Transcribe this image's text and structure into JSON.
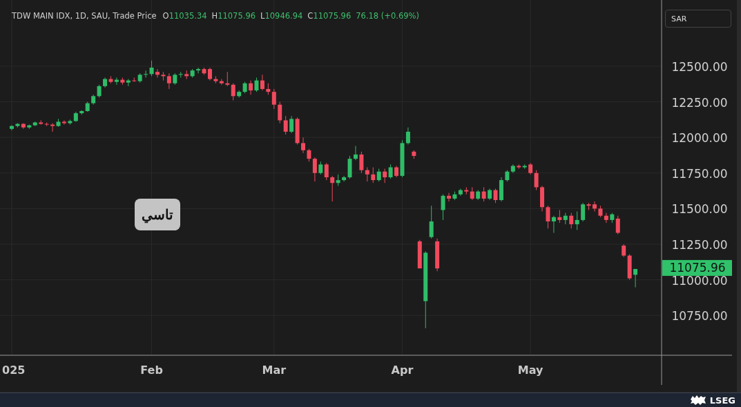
{
  "legend": {
    "symbol": "TDW MAIN IDX, 1D, SAU, Trade Price",
    "open_label": "O",
    "open": "11035.34",
    "high_label": "H",
    "high": "11075.96",
    "low_label": "L",
    "low": "10946.94",
    "close_label": "C",
    "close": "11075.96",
    "change": "76.18 (+0.69%)"
  },
  "currency_button": "SAR",
  "chart_label": "تاسي",
  "chart_data": {
    "type": "candlestick",
    "grid": true,
    "ylim": [
      10470,
      12965
    ],
    "yticks": [
      {
        "value": 10750,
        "label": "10750.00"
      },
      {
        "value": 11000,
        "label": "11000.00"
      },
      {
        "value": 11250,
        "label": "11250.00"
      },
      {
        "value": 11500,
        "label": "11500.00"
      },
      {
        "value": 11750,
        "label": "11750.00"
      },
      {
        "value": 12000,
        "label": "12000.00"
      },
      {
        "value": 12250,
        "label": "12250.00"
      },
      {
        "value": 12500,
        "label": "12500.00"
      }
    ],
    "categories": [
      "025",
      null,
      null,
      null,
      null,
      null,
      null,
      null,
      null,
      null,
      null,
      null,
      null,
      null,
      null,
      null,
      null,
      null,
      null,
      null,
      null,
      null,
      null,
      null,
      "Feb",
      null,
      null,
      null,
      null,
      null,
      null,
      null,
      null,
      null,
      null,
      null,
      null,
      null,
      null,
      null,
      null,
      null,
      null,
      null,
      null,
      "Mar",
      null,
      null,
      null,
      null,
      null,
      null,
      null,
      null,
      null,
      null,
      null,
      null,
      null,
      null,
      null,
      null,
      null,
      null,
      null,
      null,
      null,
      "Apr",
      null,
      null,
      null,
      null,
      null,
      null,
      null,
      null,
      null,
      null,
      null,
      null,
      null,
      null,
      null,
      null,
      null,
      null,
      null,
      null,
      null,
      "May",
      null,
      null,
      null,
      null,
      null,
      null,
      null,
      null,
      null,
      null,
      null,
      null,
      null,
      null,
      null,
      null,
      null,
      null
    ],
    "ohlc": [
      [
        12060,
        12085,
        12050,
        12080
      ],
      [
        12080,
        12100,
        12070,
        12095
      ],
      [
        12095,
        12100,
        12060,
        12070
      ],
      [
        12070,
        12090,
        12060,
        12085
      ],
      [
        12085,
        12110,
        12080,
        12105
      ],
      [
        12105,
        12120,
        12090,
        12095
      ],
      [
        12095,
        12105,
        12080,
        12090
      ],
      [
        12090,
        12100,
        12040,
        12080
      ],
      [
        12080,
        12130,
        12075,
        12110
      ],
      [
        12110,
        12120,
        12090,
        12100
      ],
      [
        12100,
        12125,
        12090,
        12115
      ],
      [
        12115,
        12180,
        12110,
        12170
      ],
      [
        12170,
        12190,
        12160,
        12185
      ],
      [
        12185,
        12250,
        12180,
        12240
      ],
      [
        12240,
        12300,
        12230,
        12290
      ],
      [
        12290,
        12370,
        12280,
        12360
      ],
      [
        12360,
        12420,
        12350,
        12410
      ],
      [
        12410,
        12430,
        12380,
        12390
      ],
      [
        12390,
        12420,
        12370,
        12405
      ],
      [
        12405,
        12420,
        12370,
        12385
      ],
      [
        12385,
        12410,
        12360,
        12400
      ],
      [
        12400,
        12420,
        12390,
        12395
      ],
      [
        12395,
        12450,
        12385,
        12440
      ],
      [
        12440,
        12470,
        12420,
        12445
      ],
      [
        12445,
        12540,
        12430,
        12490
      ],
      [
        12460,
        12480,
        12420,
        12440
      ],
      [
        12440,
        12460,
        12400,
        12430
      ],
      [
        12430,
        12450,
        12340,
        12380
      ],
      [
        12380,
        12450,
        12370,
        12440
      ],
      [
        12440,
        12460,
        12420,
        12445
      ],
      [
        12445,
        12470,
        12410,
        12430
      ],
      [
        12430,
        12480,
        12420,
        12470
      ],
      [
        12470,
        12490,
        12450,
        12480
      ],
      [
        12480,
        12490,
        12440,
        12450
      ],
      [
        12480,
        12490,
        12400,
        12410
      ],
      [
        12410,
        12430,
        12380,
        12395
      ],
      [
        12395,
        12410,
        12370,
        12380
      ],
      [
        12380,
        12460,
        12360,
        12370
      ],
      [
        12370,
        12380,
        12260,
        12290
      ],
      [
        12290,
        12330,
        12280,
        12320
      ],
      [
        12320,
        12390,
        12310,
        12380
      ],
      [
        12380,
        12400,
        12300,
        12330
      ],
      [
        12330,
        12420,
        12320,
        12400
      ],
      [
        12400,
        12440,
        12330,
        12340
      ],
      [
        12340,
        12380,
        12300,
        12320
      ],
      [
        12320,
        12340,
        12200,
        12230
      ],
      [
        12230,
        12250,
        12100,
        12120
      ],
      [
        12120,
        12150,
        12020,
        12040
      ],
      [
        12040,
        12150,
        12030,
        12130
      ],
      [
        12130,
        12140,
        11950,
        11960
      ],
      [
        11960,
        12000,
        11890,
        11910
      ],
      [
        11910,
        11920,
        11830,
        11850
      ],
      [
        11850,
        11860,
        11690,
        11750
      ],
      [
        11750,
        11830,
        11740,
        11810
      ],
      [
        11810,
        11820,
        11700,
        11720
      ],
      [
        11720,
        11730,
        11550,
        11680
      ],
      [
        11680,
        11740,
        11660,
        11700
      ],
      [
        11700,
        11730,
        11690,
        11720
      ],
      [
        11720,
        11870,
        11710,
        11850
      ],
      [
        11850,
        11940,
        11840,
        11880
      ],
      [
        11880,
        11900,
        11750,
        11770
      ],
      [
        11770,
        11790,
        11690,
        11740
      ],
      [
        11740,
        11790,
        11680,
        11700
      ],
      [
        11700,
        11780,
        11690,
        11760
      ],
      [
        11760,
        11780,
        11680,
        11720
      ],
      [
        11720,
        11810,
        11710,
        11790
      ],
      [
        11790,
        11800,
        11720,
        11730
      ],
      [
        11730,
        11980,
        11720,
        11960
      ],
      [
        11960,
        12070,
        11950,
        12040
      ],
      [
        11900,
        11910,
        11850,
        11870
      ],
      [
        11270,
        11280,
        11080,
        11080
      ],
      [
        10850,
        11200,
        10660,
        11190
      ],
      [
        11300,
        11520,
        11290,
        11410
      ],
      [
        11270,
        11290,
        11060,
        11080
      ],
      [
        11490,
        11600,
        11420,
        11590
      ],
      [
        11590,
        11610,
        11550,
        11570
      ],
      [
        11570,
        11620,
        11560,
        11600
      ],
      [
        11600,
        11640,
        11590,
        11630
      ],
      [
        11630,
        11650,
        11600,
        11620
      ],
      [
        11620,
        11650,
        11560,
        11570
      ],
      [
        11570,
        11630,
        11560,
        11620
      ],
      [
        11620,
        11650,
        11550,
        11570
      ],
      [
        11570,
        11640,
        11560,
        11630
      ],
      [
        11630,
        11640,
        11540,
        11560
      ],
      [
        11560,
        11720,
        11550,
        11700
      ],
      [
        11700,
        11770,
        11690,
        11760
      ],
      [
        11760,
        11810,
        11750,
        11800
      ],
      [
        11800,
        11810,
        11780,
        11790
      ],
      [
        11790,
        11810,
        11780,
        11800
      ],
      [
        11810,
        11820,
        11740,
        11750
      ],
      [
        11750,
        11770,
        11630,
        11650
      ],
      [
        11650,
        11660,
        11480,
        11510
      ],
      [
        11510,
        11520,
        11360,
        11410
      ],
      [
        11410,
        11450,
        11330,
        11440
      ],
      [
        11440,
        11490,
        11400,
        11420
      ],
      [
        11420,
        11470,
        11390,
        11450
      ],
      [
        11450,
        11470,
        11360,
        11390
      ],
      [
        11390,
        11480,
        11350,
        11420
      ],
      [
        11420,
        11540,
        11410,
        11530
      ],
      [
        11530,
        11540,
        11490,
        11520
      ],
      [
        11530,
        11550,
        11480,
        11500
      ],
      [
        11500,
        11520,
        11440,
        11450
      ],
      [
        11450,
        11470,
        11400,
        11420
      ],
      [
        11420,
        11470,
        11400,
        11460
      ],
      [
        11430,
        11450,
        11320,
        11330
      ],
      [
        11240,
        11250,
        11160,
        11170
      ],
      [
        11170,
        11180,
        11000,
        11010
      ],
      [
        11035.34,
        11075.96,
        10946.94,
        11075.96
      ]
    ],
    "annotations": [
      "11075.96"
    ]
  },
  "footer": {
    "brand": "LSEG"
  }
}
